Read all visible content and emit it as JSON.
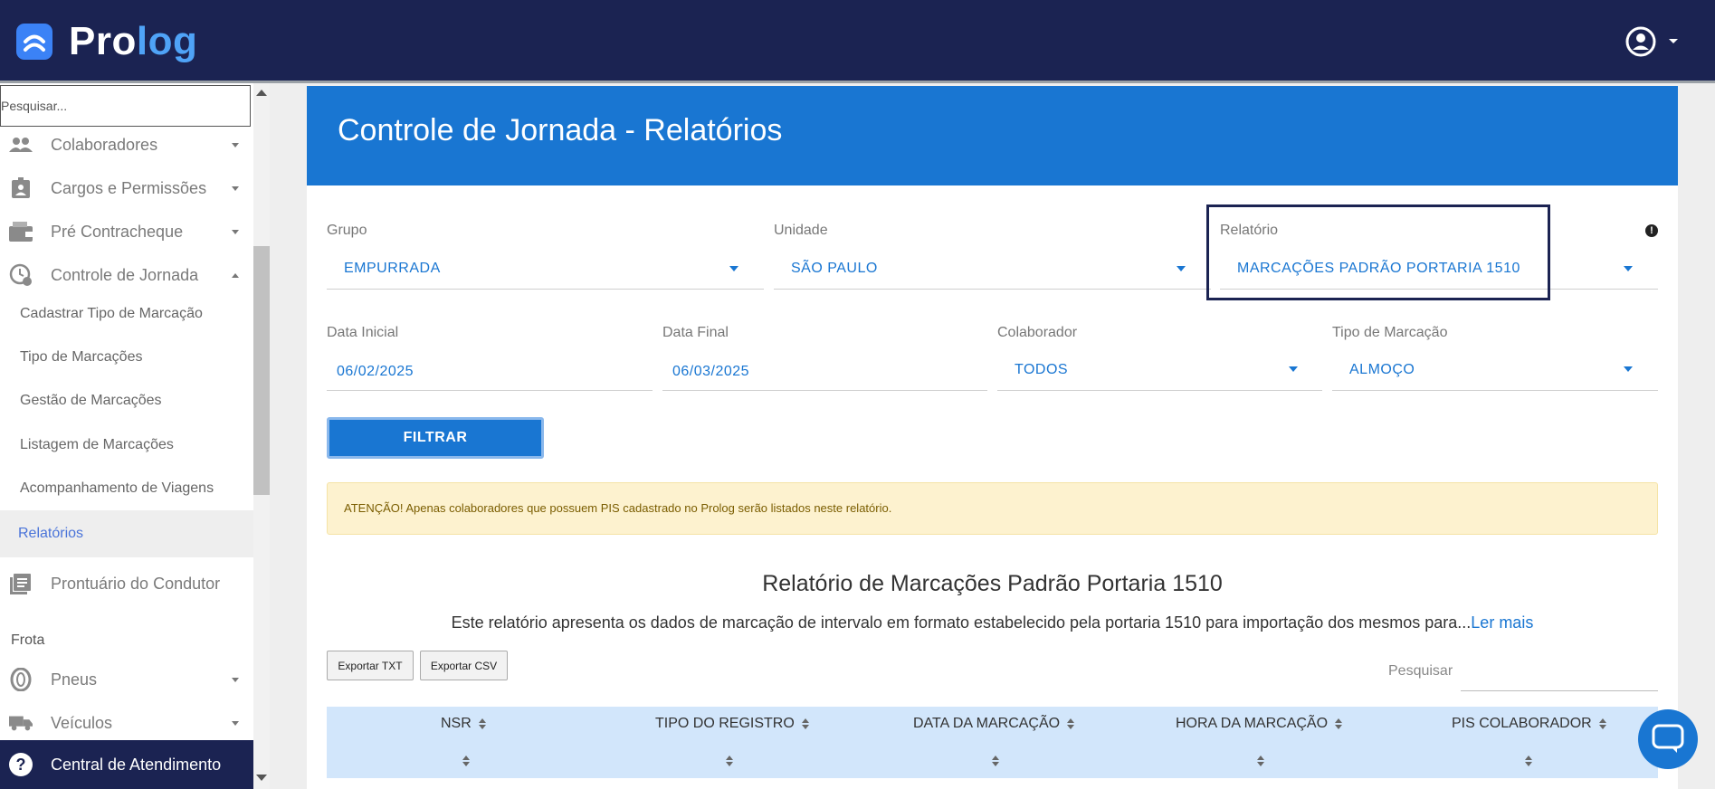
{
  "app": {
    "logo_pro": "Pro",
    "logo_log": "log"
  },
  "sidebar": {
    "search_placeholder": "Pesquisar...",
    "menu": [
      {
        "label": "Colaboradores",
        "icon": "people-icon"
      },
      {
        "label": "Cargos e Permissões",
        "icon": "badge-icon"
      },
      {
        "label": "Pré Contracheque",
        "icon": "wallet-icon"
      },
      {
        "label": "Controle de Jornada",
        "icon": "clock-check-icon"
      }
    ],
    "submenu": [
      {
        "label": "Cadastrar Tipo de Marcação"
      },
      {
        "label": "Tipo de Marcações"
      },
      {
        "label": "Gestão de Marcações"
      },
      {
        "label": "Listagem de Marcações"
      },
      {
        "label": "Acompanhamento de Viagens"
      },
      {
        "label": "Relatórios",
        "active": true
      }
    ],
    "prontuario": {
      "label": "Prontuário do Condutor",
      "icon": "document-icon"
    },
    "section_frota": "Frota",
    "frota": [
      {
        "label": "Pneus",
        "icon": "tire-icon"
      },
      {
        "label": "Veículos",
        "icon": "truck-icon"
      }
    ],
    "central": {
      "label": "Central de Atendimento",
      "icon": "help-icon"
    }
  },
  "page": {
    "title": "Controle de Jornada - Relatórios",
    "filters": {
      "grupo": {
        "label": "Grupo",
        "value": "EMPURRADA"
      },
      "unidade": {
        "label": "Unidade",
        "value": "SÃO PAULO"
      },
      "relatorio": {
        "label": "Relatório",
        "value": "MARCAÇÕES PADRÃO PORTARIA 1510"
      },
      "data_inicial": {
        "label": "Data Inicial",
        "value": "06/02/2025"
      },
      "data_final": {
        "label": "Data Final",
        "value": "06/03/2025"
      },
      "colaborador": {
        "label": "Colaborador",
        "value": "TODOS"
      },
      "tipo_marcacao": {
        "label": "Tipo de Marcação",
        "value": "ALMOÇO"
      }
    },
    "filter_button": "FILTRAR",
    "alert": "ATENÇÃO! Apenas colaboradores que possuem PIS cadastrado no Prolog serão listados neste relatório.",
    "report": {
      "title": "Relatório de Marcações Padrão Portaria 1510",
      "description": "Este relatório apresenta os dados de marcação de intervalo em formato estabelecido pela portaria 1510 para importação dos mesmos para...",
      "read_more": "Ler mais"
    },
    "export_txt": "Exportar TXT",
    "export_csv": "Exportar CSV",
    "table_search_label": "Pesquisar",
    "table": {
      "columns": [
        "NSR",
        "TIPO DO REGISTRO",
        "DATA DA MARCAÇÃO",
        "HORA DA MARCAÇÃO",
        "PIS COLABORADOR"
      ]
    }
  },
  "colors": {
    "topbar": "#1b2352",
    "primary": "#1976d2",
    "alert_bg": "#fdf2cf",
    "table_header_bg": "#d2e6fb"
  }
}
